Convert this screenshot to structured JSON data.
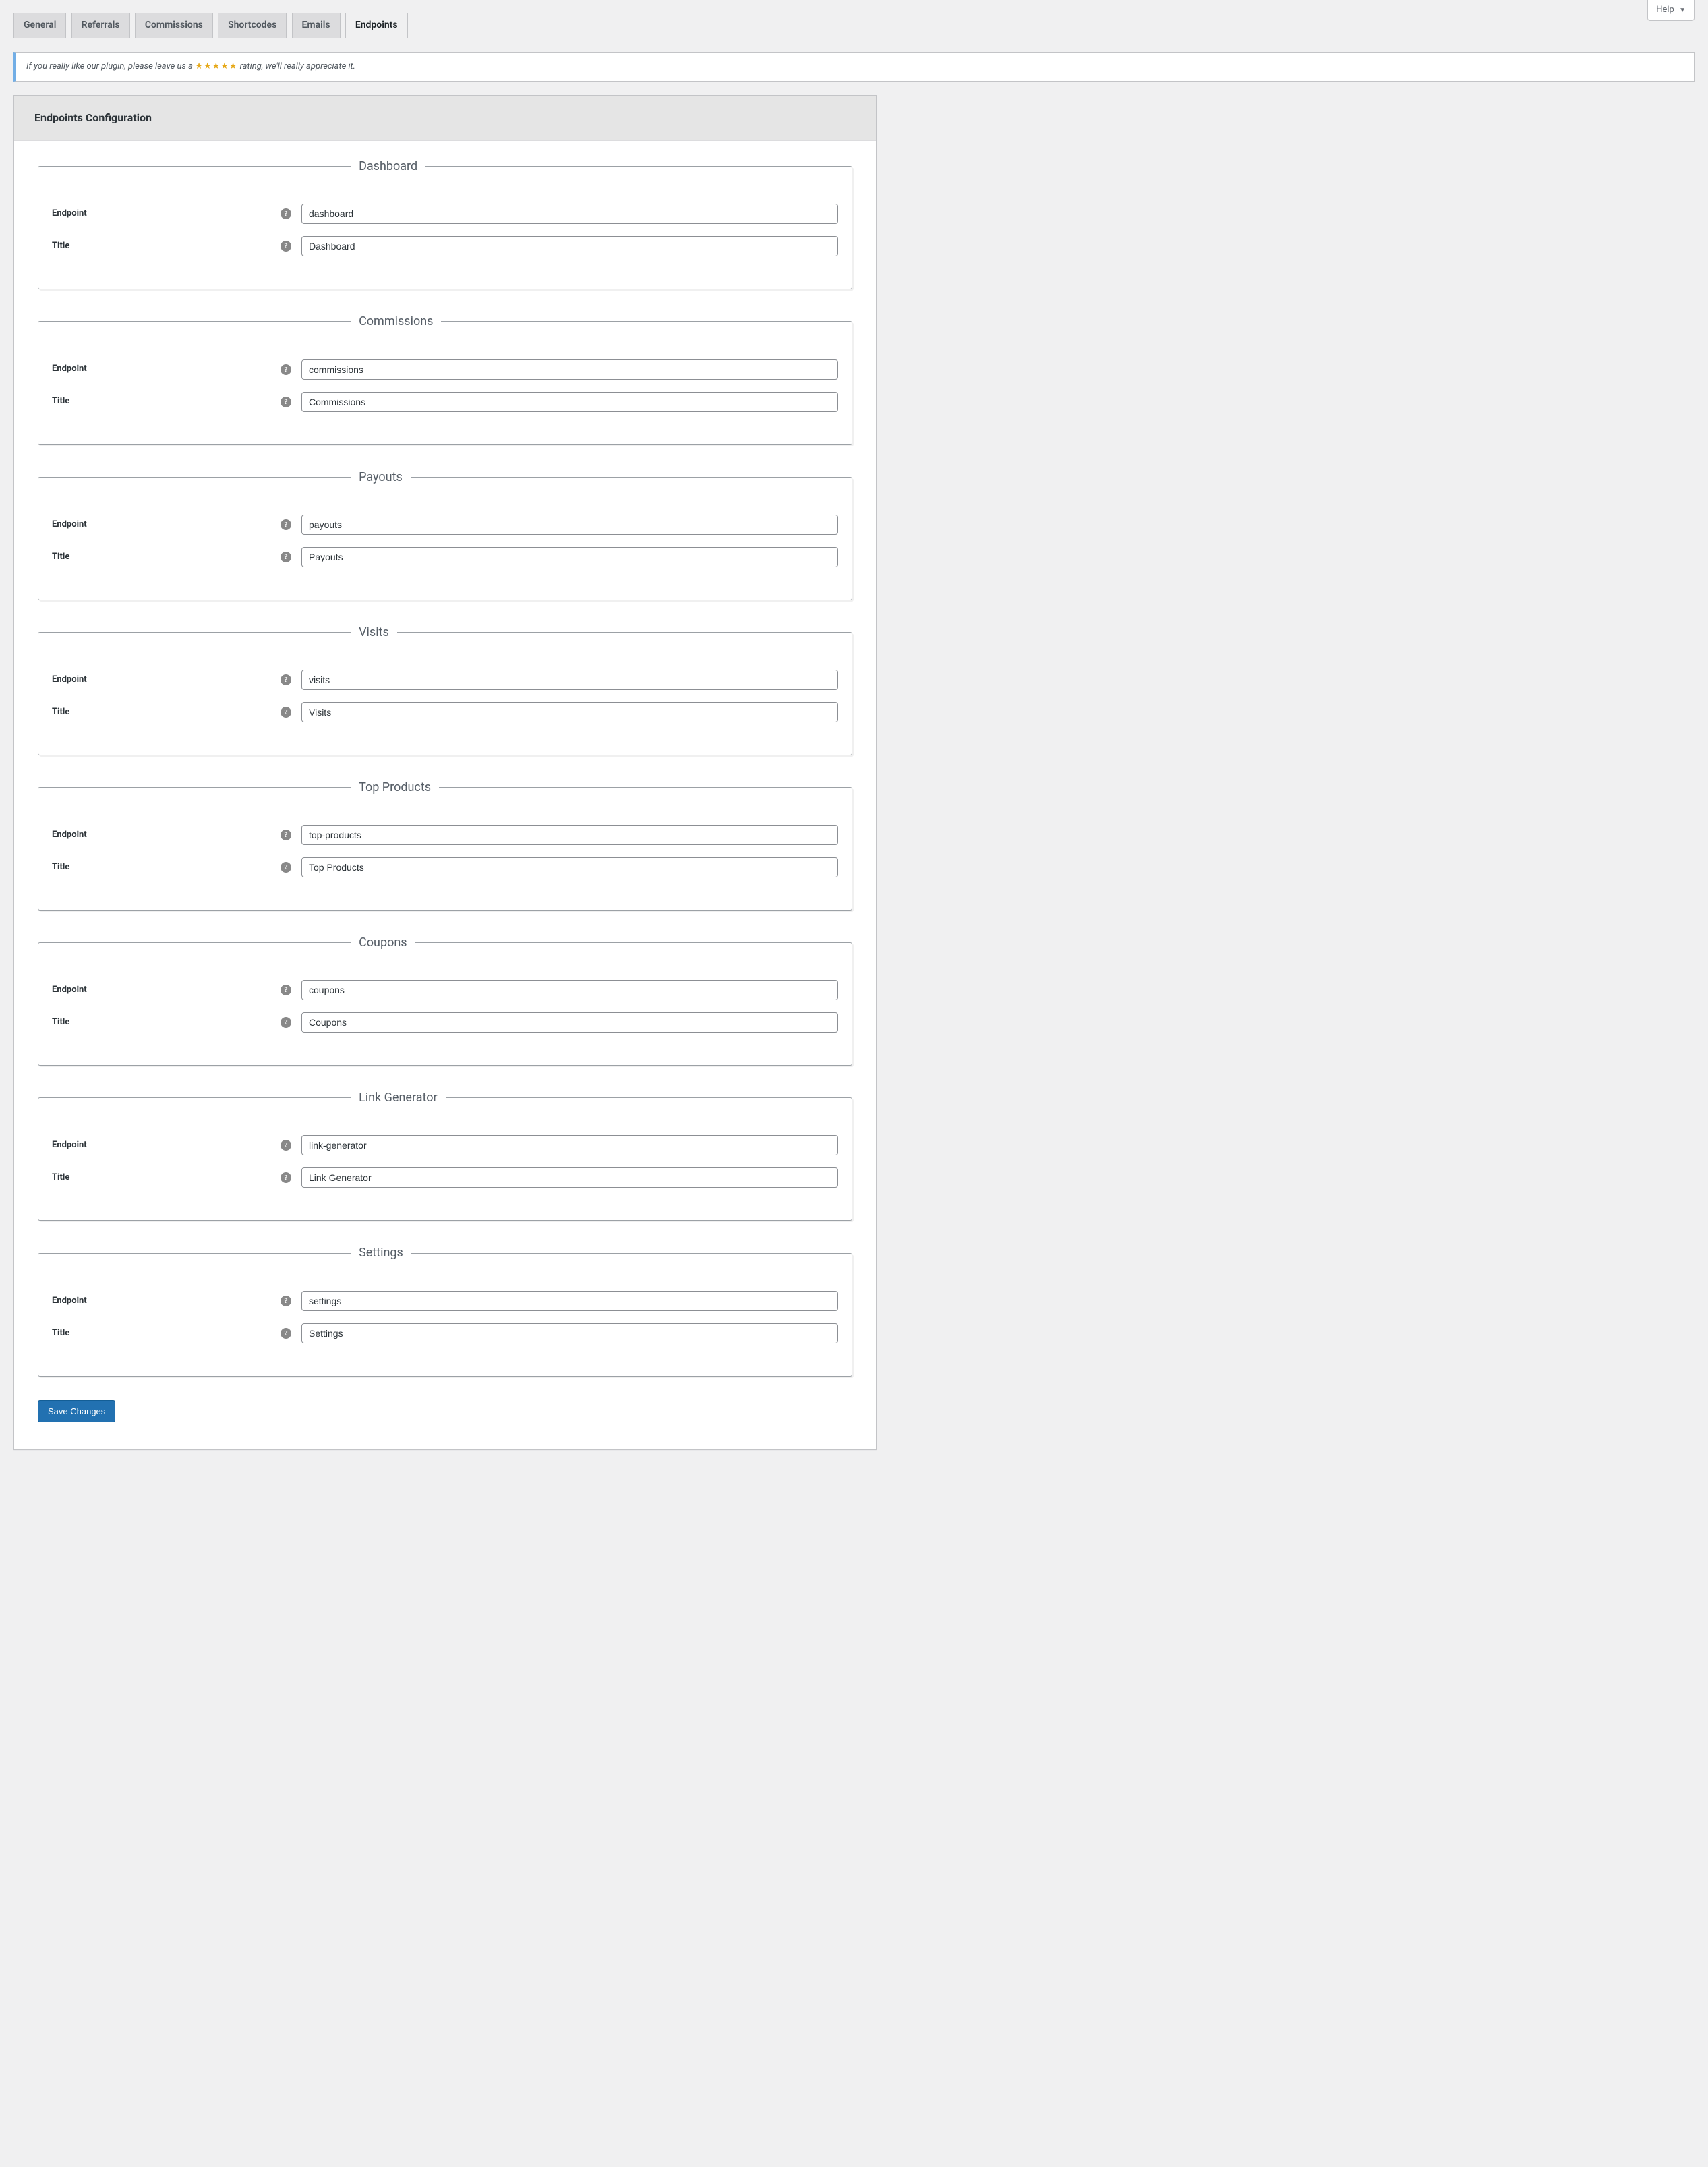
{
  "help_tab": "Help",
  "tabs": [
    {
      "label": "General"
    },
    {
      "label": "Referrals"
    },
    {
      "label": "Commissions"
    },
    {
      "label": "Shortcodes"
    },
    {
      "label": "Emails"
    },
    {
      "label": "Endpoints"
    }
  ],
  "notice": {
    "pre": "If you really like our plugin, please leave us a ",
    "stars": "★★★★★",
    "post": " rating, we'll really appreciate it."
  },
  "panel_title": "Endpoints Configuration",
  "row_labels": {
    "endpoint": "Endpoint",
    "title": "Title"
  },
  "sections": [
    {
      "legend": "Dashboard",
      "endpoint": "dashboard",
      "title": "Dashboard"
    },
    {
      "legend": "Commissions",
      "endpoint": "commissions",
      "title": "Commissions"
    },
    {
      "legend": "Payouts",
      "endpoint": "payouts",
      "title": "Payouts"
    },
    {
      "legend": "Visits",
      "endpoint": "visits",
      "title": "Visits"
    },
    {
      "legend": "Top Products",
      "endpoint": "top-products",
      "title": "Top Products"
    },
    {
      "legend": "Coupons",
      "endpoint": "coupons",
      "title": "Coupons"
    },
    {
      "legend": "Link Generator",
      "endpoint": "link-generator",
      "title": "Link Generator"
    },
    {
      "legend": "Settings",
      "endpoint": "settings",
      "title": "Settings"
    }
  ],
  "save_button": "Save Changes"
}
